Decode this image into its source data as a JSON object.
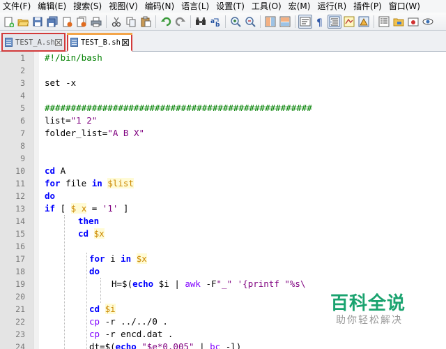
{
  "menu": [
    "文件(F)",
    "编辑(E)",
    "搜索(S)",
    "视图(V)",
    "编码(N)",
    "语言(L)",
    "设置(T)",
    "工具(O)",
    "宏(M)",
    "运行(R)",
    "插件(P)",
    "窗口(W)"
  ],
  "toolbar": {
    "buttons": [
      {
        "name": "new-file-icon"
      },
      {
        "name": "open-file-icon"
      },
      {
        "name": "save-icon"
      },
      {
        "name": "save-all-icon"
      },
      {
        "name": "close-file-icon"
      },
      {
        "name": "close-all-icon"
      },
      {
        "name": "print-icon"
      },
      {
        "name": "cut-icon"
      },
      {
        "name": "copy-icon"
      },
      {
        "name": "paste-icon"
      },
      {
        "name": "undo-icon"
      },
      {
        "name": "redo-icon"
      },
      {
        "name": "find-icon"
      },
      {
        "name": "replace-icon"
      },
      {
        "name": "zoom-in-icon"
      },
      {
        "name": "zoom-out-icon"
      },
      {
        "name": "sync-vertical-icon"
      },
      {
        "name": "sync-horizontal-icon"
      },
      {
        "name": "word-wrap-icon"
      },
      {
        "name": "show-all-chars-icon"
      },
      {
        "name": "indent-guide-icon"
      },
      {
        "name": "user-language-icon"
      },
      {
        "name": "doc-map-icon"
      },
      {
        "name": "function-list-icon"
      },
      {
        "name": "folder-as-workspace-icon"
      },
      {
        "name": "record-macro-icon"
      },
      {
        "name": "monitoring-icon"
      }
    ]
  },
  "tabs": [
    {
      "label": "TEST_A.sh",
      "active": false
    },
    {
      "label": "TEST_B.sh",
      "active": true
    }
  ],
  "colors": {
    "tab_highlight": "#d23a3a",
    "keyword": "#0000ff",
    "variable": "#cc8800",
    "string": "#7f007f",
    "comment": "#008000",
    "watermark": "#1aa36f"
  },
  "code_lines": [
    {
      "n": "1",
      "indent": 0,
      "tokens": [
        {
          "t": "#!/bin/bash",
          "c": "cmt"
        }
      ]
    },
    {
      "n": "2",
      "indent": 0,
      "tokens": []
    },
    {
      "n": "3",
      "indent": 0,
      "tokens": [
        {
          "t": "set -x",
          "c": "plain"
        }
      ]
    },
    {
      "n": "4",
      "indent": 0,
      "tokens": []
    },
    {
      "n": "5",
      "indent": 0,
      "tokens": [
        {
          "t": "###################################################",
          "c": "cmt"
        }
      ]
    },
    {
      "n": "6",
      "indent": 0,
      "tokens": [
        {
          "t": "list=",
          "c": "plain"
        },
        {
          "t": "\"1 2\"",
          "c": "str"
        }
      ]
    },
    {
      "n": "7",
      "indent": 0,
      "tokens": [
        {
          "t": "folder_list=",
          "c": "plain"
        },
        {
          "t": "\"A B X\"",
          "c": "str"
        }
      ]
    },
    {
      "n": "8",
      "indent": 0,
      "tokens": []
    },
    {
      "n": "9",
      "indent": 0,
      "tokens": []
    },
    {
      "n": "10",
      "indent": 0,
      "tokens": [
        {
          "t": "cd",
          "c": "kw"
        },
        {
          "t": " A",
          "c": "plain"
        }
      ]
    },
    {
      "n": "11",
      "indent": 0,
      "tokens": [
        {
          "t": "for",
          "c": "kw"
        },
        {
          "t": " file ",
          "c": "plain"
        },
        {
          "t": "in",
          "c": "kw"
        },
        {
          "t": " ",
          "c": "plain"
        },
        {
          "t": "$list",
          "c": "var"
        }
      ]
    },
    {
      "n": "12",
      "indent": 0,
      "tokens": [
        {
          "t": "do",
          "c": "kw"
        }
      ]
    },
    {
      "n": "13",
      "indent": 0,
      "tokens": [
        {
          "t": "if",
          "c": "kw"
        },
        {
          "t": " [ ",
          "c": "plain"
        },
        {
          "t": "$ x",
          "c": "var"
        },
        {
          "t": " = ",
          "c": "plain"
        },
        {
          "t": "'1'",
          "c": "str"
        },
        {
          "t": " ]",
          "c": "plain"
        }
      ]
    },
    {
      "n": "14",
      "indent": 6,
      "tokens": [
        {
          "t": "then",
          "c": "kw"
        }
      ]
    },
    {
      "n": "15",
      "indent": 6,
      "tokens": [
        {
          "t": "cd",
          "c": "kw"
        },
        {
          "t": " ",
          "c": "plain"
        },
        {
          "t": "$x",
          "c": "var"
        }
      ]
    },
    {
      "n": "16",
      "indent": 0,
      "tokens": []
    },
    {
      "n": "17",
      "indent": 8,
      "tokens": [
        {
          "t": "for",
          "c": "kw"
        },
        {
          "t": " i ",
          "c": "plain"
        },
        {
          "t": "in",
          "c": "kw"
        },
        {
          "t": " ",
          "c": "plain"
        },
        {
          "t": "$x",
          "c": "var"
        }
      ]
    },
    {
      "n": "18",
      "indent": 8,
      "tokens": [
        {
          "t": "do",
          "c": "kw"
        }
      ]
    },
    {
      "n": "19",
      "indent": 12,
      "tokens": [
        {
          "t": "H=$(",
          "c": "plain"
        },
        {
          "t": "echo",
          "c": "kw"
        },
        {
          "t": " $i | ",
          "c": "plain"
        },
        {
          "t": "awk",
          "c": "cmd"
        },
        {
          "t": " -F",
          "c": "plain"
        },
        {
          "t": "\"_\"",
          "c": "str"
        },
        {
          "t": " ",
          "c": "plain"
        },
        {
          "t": "'{printf \"%s\\",
          "c": "str"
        }
      ]
    },
    {
      "n": "20",
      "indent": 0,
      "tokens": []
    },
    {
      "n": "21",
      "indent": 8,
      "tokens": [
        {
          "t": "cd",
          "c": "kw"
        },
        {
          "t": " ",
          "c": "plain"
        },
        {
          "t": "$i",
          "c": "var"
        }
      ]
    },
    {
      "n": "22",
      "indent": 8,
      "tokens": [
        {
          "t": "cp",
          "c": "cmd"
        },
        {
          "t": " -r ../../0 .",
          "c": "plain"
        }
      ]
    },
    {
      "n": "23",
      "indent": 8,
      "tokens": [
        {
          "t": "cp",
          "c": "cmd"
        },
        {
          "t": " -r encd.dat .",
          "c": "plain"
        }
      ]
    },
    {
      "n": "24",
      "indent": 8,
      "tokens": [
        {
          "t": "dt=$(",
          "c": "plain"
        },
        {
          "t": "echo",
          "c": "kw"
        },
        {
          "t": " ",
          "c": "plain"
        },
        {
          "t": "\"$e*0.005\"",
          "c": "str"
        },
        {
          "t": " | ",
          "c": "plain"
        },
        {
          "t": "bc",
          "c": "cmd"
        },
        {
          "t": " -l)",
          "c": "plain"
        }
      ]
    }
  ],
  "watermark": {
    "title": "百科全说",
    "subtitle": "助你轻松解决"
  }
}
